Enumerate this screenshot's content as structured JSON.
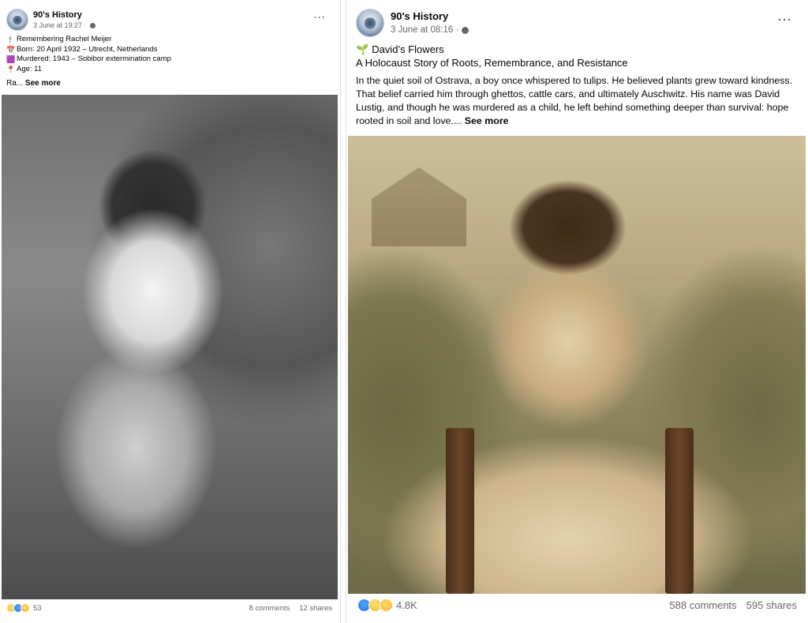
{
  "posts": [
    {
      "page_name": "90's History",
      "timestamp": "3 June at 19:27 ·",
      "privacy_icon": "globe-icon",
      "more_label": "···",
      "caption_lines": [
        {
          "icon": "candle-icon",
          "glyph": "🕯",
          "text": "Remembering Rachel Meijer"
        },
        {
          "icon": "calendar-icon",
          "glyph": "📅",
          "text": "Born: 20 April 1932 – Utrecht, Netherlands"
        },
        {
          "icon": "purple-square-icon",
          "glyph": "🟪",
          "text": "Murdered: 1943 – Sobibor extermination camp"
        },
        {
          "icon": "pin-icon",
          "glyph": "📍",
          "text": "Age: 11"
        }
      ],
      "truncated_text": "Ra... ",
      "see_more": "See more",
      "reactions": [
        "sad",
        "like",
        "care"
      ],
      "reaction_count": "53",
      "comments": "8 comments",
      "shares": "12 shares"
    },
    {
      "page_name": "90's History",
      "timestamp": "3 June at 08:16 ·",
      "privacy_icon": "globe-icon",
      "more_label": "···",
      "sprout_glyph": "🌱",
      "title": "David’s Flowers",
      "subtitle": "A Holocaust Story of Roots, Remembrance, and Resistance",
      "body": "In the quiet soil of Ostrava, a boy once whispered to tulips. He believed plants grew toward kindness. That belief carried him through ghettos, cattle cars, and ultimately Auschwitz. His name was David Lustig, and though he was murdered as a child, he left behind something deeper than survival: hope rooted in soil and love.... ",
      "see_more": "See more",
      "reactions": [
        "like",
        "sad",
        "care"
      ],
      "reaction_count": "4.8K",
      "comments": "588 comments",
      "shares": "595 shares"
    }
  ]
}
